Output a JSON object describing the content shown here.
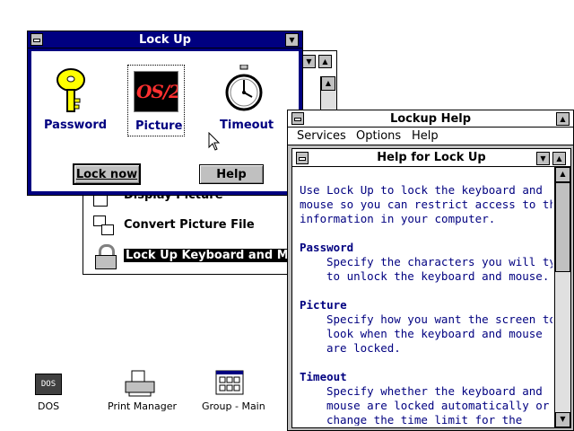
{
  "lockup_dialog": {
    "title": "Lock Up",
    "options": [
      {
        "label": "Password"
      },
      {
        "label": "Picture"
      },
      {
        "label": "Timeout"
      }
    ],
    "picture_badge": "OS/2",
    "lock_now_label": "Lock now",
    "help_label": "Help"
  },
  "background_list": {
    "items": [
      {
        "label": "Display Picture"
      },
      {
        "label": "Convert Picture File"
      },
      {
        "label": "Lock Up Keyboard and Mous"
      }
    ]
  },
  "help_window": {
    "title": "Lockup Help",
    "menu": [
      "Services",
      "Options",
      "Help"
    ],
    "inner_title": "Help for Lock Up",
    "intro_lines": [
      "Use Lock Up to lock the keyboard and",
      "mouse so you can restrict access to the",
      "information in your computer."
    ],
    "sections": [
      {
        "heading": "Password",
        "lines": [
          "Specify the characters you will type",
          "to unlock the keyboard and mouse."
        ]
      },
      {
        "heading": "Picture",
        "lines": [
          "Specify how you want the screen to",
          "look when the keyboard and mouse",
          "are locked."
        ]
      },
      {
        "heading": "Timeout",
        "lines": [
          "Specify whether the keyboard and",
          "mouse are locked automatically or",
          "change the time limit for the"
        ]
      }
    ]
  },
  "desktop_icons": [
    {
      "label": "DOS",
      "badge": "DOS"
    },
    {
      "label": "Print Manager"
    },
    {
      "label": "Group - Main"
    }
  ],
  "colors": {
    "title_active": "#000080",
    "help_text": "#000080",
    "face": "#c0c0c0"
  }
}
